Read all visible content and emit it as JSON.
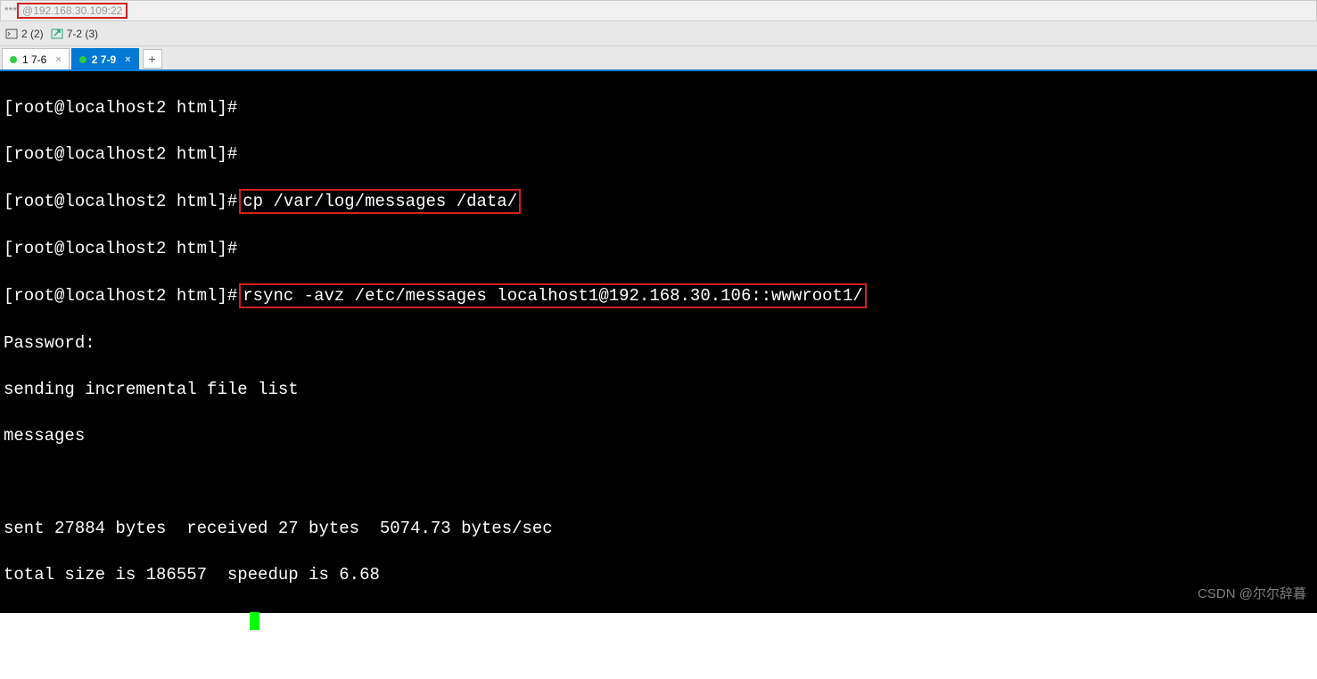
{
  "titlebar": {
    "prefix": "*** ",
    "host": "@192.168.30.109:22"
  },
  "toolbar": {
    "item1": "2 (2)",
    "item2": "7-2 (3)"
  },
  "tabs": {
    "tab1_label": "1 7-6",
    "tab2_label": "2 7-9",
    "add_symbol": "+"
  },
  "terminal": {
    "prompt": "[root@localhost2 html]#",
    "cmd1": "cp /var/log/messages /data/",
    "cmd2": "rsync -avz /etc/messages localhost1@192.168.30.106::wwwroot1/",
    "out1": "Password:",
    "out2": "sending incremental file list",
    "out3": "messages",
    "out4": "sent 27884 bytes  received 27 bytes  5074.73 bytes/sec",
    "out5": "total size is 186557  speedup is 6.68"
  },
  "watermark": "CSDN @尔尔辞暮"
}
